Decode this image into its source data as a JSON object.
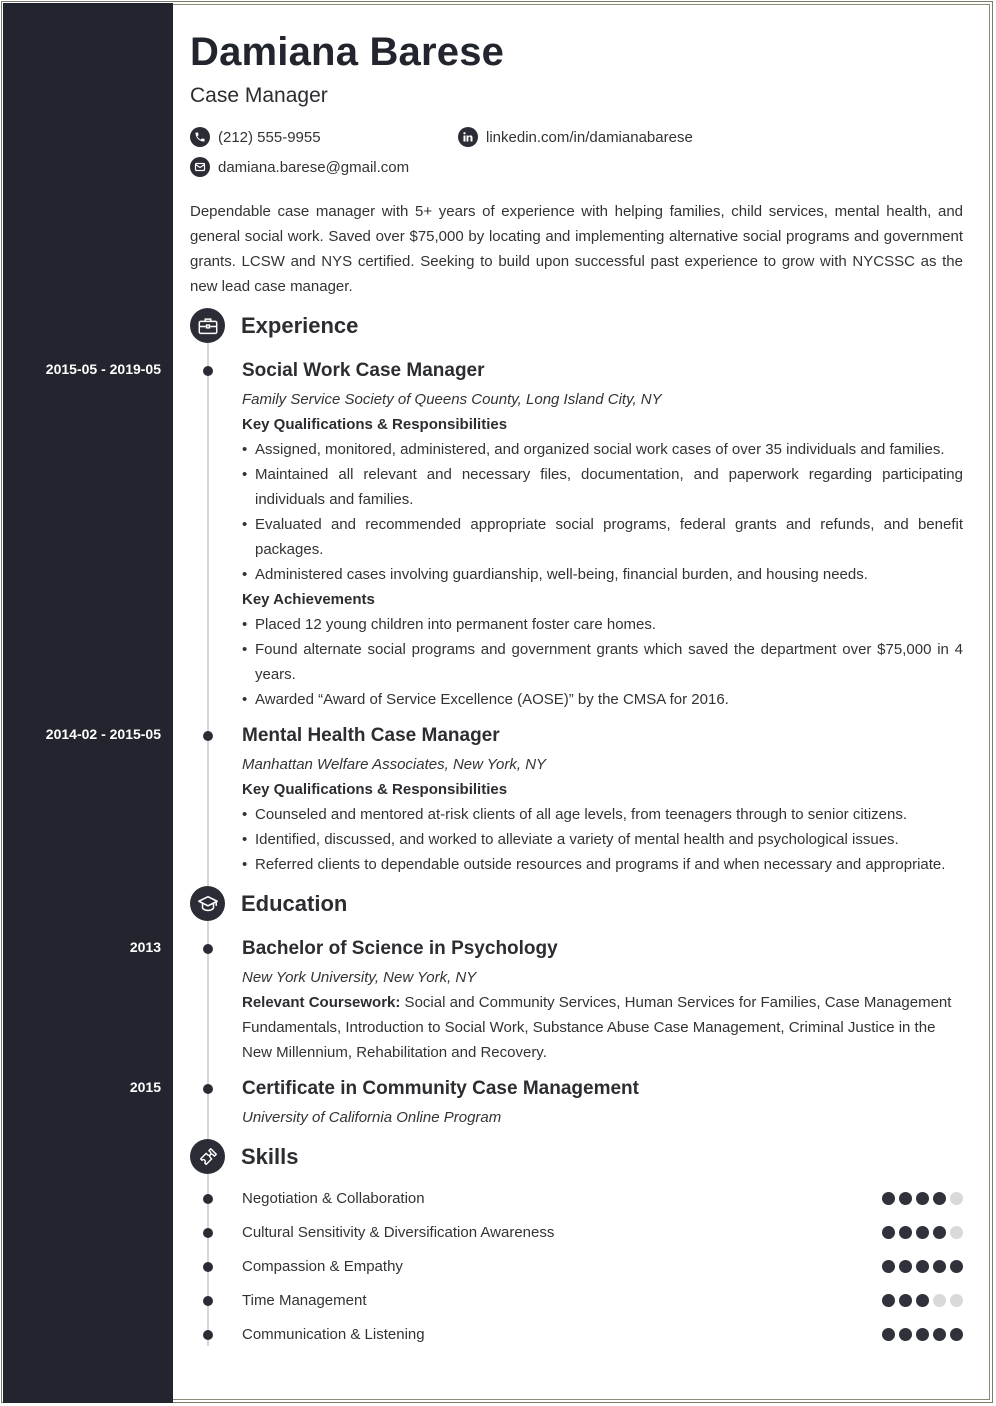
{
  "header": {
    "name": "Damiana Barese",
    "title": "Case Manager",
    "contacts": {
      "phone": "(212) 555-9955",
      "linkedin": "linkedin.com/in/damianabarese",
      "email": "damiana.barese@gmail.com"
    }
  },
  "summary": "Dependable case manager with 5+ years of experience with helping families, child services, mental health, and general social work. Saved over $75,000 by locating and implementing alternative social programs and government grants. LCSW and NYS certified. Seeking to build upon successful past experience to grow with NYCSSC as the new lead case manager.",
  "sections": {
    "experience": "Experience",
    "education": "Education",
    "skills": "Skills"
  },
  "experience": [
    {
      "dates": "2015-05 - 2019-05",
      "title": "Social Work Case Manager",
      "employer": "Family Service Society of Queens County, Long Island City, NY",
      "qual_heading": "Key Qualifications & Responsibilities",
      "qualifications": [
        "Assigned, monitored, administered, and organized social work cases of over 35 individuals and families.",
        "Maintained all relevant and necessary files, documentation, and paperwork regarding participating individuals and families.",
        "Evaluated and recommended appropriate social programs, federal grants and refunds, and benefit packages.",
        "Administered cases involving guardianship, well-being, financial burden, and housing needs."
      ],
      "ach_heading": "Key Achievements",
      "achievements": [
        "Placed 12 young children into permanent foster care homes.",
        "Found alternate social programs and government grants which saved the department over $75,000 in 4 years.",
        "Awarded “Award of Service Excellence (AOSE)” by the CMSA for 2016."
      ]
    },
    {
      "dates": "2014-02 - 2015-05",
      "title": "Mental Health Case Manager",
      "employer": "Manhattan Welfare Associates, New York, NY",
      "qual_heading": "Key Qualifications & Responsibilities",
      "qualifications": [
        "Counseled and mentored at-risk clients of all age levels, from teenagers through to senior citizens.",
        "Identified, discussed, and worked to alleviate a variety of mental health and psychological issues.",
        "Referred clients to dependable outside resources and programs if and when necessary and appropriate."
      ]
    }
  ],
  "education": [
    {
      "date": "2013",
      "degree": "Bachelor of Science in Psychology",
      "school": "New York University, New York, NY",
      "coursework_label": "Relevant Coursework:",
      "coursework": " Social and Community Services, Human Services for Families, Case Management Fundamentals, Introduction to Social Work, Substance Abuse Case Management, Criminal Justice in the New Millennium, Rehabilitation and Recovery."
    },
    {
      "date": "2015",
      "degree": "Certificate in Community Case Management",
      "school": "University of California Online Program"
    }
  ],
  "skills": [
    {
      "name": "Negotiation & Collaboration",
      "rating": 4,
      "max": 5
    },
    {
      "name": "Cultural Sensitivity & Diversification Awareness",
      "rating": 4,
      "max": 5
    },
    {
      "name": "Compassion & Empathy",
      "rating": 5,
      "max": 5
    },
    {
      "name": "Time Management",
      "rating": 3,
      "max": 5
    },
    {
      "name": "Communication & Listening",
      "rating": 5,
      "max": 5
    }
  ],
  "icons": {
    "phone": "phone-icon",
    "linkedin": "linkedin-icon",
    "email": "email-icon",
    "experience": "briefcase-icon",
    "education": "graduation-cap-icon",
    "skills": "puzzle-piece-icon"
  },
  "colors": {
    "sidebar": "#22252d",
    "accent": "#2a2d35",
    "rating_on": "#2f323b",
    "rating_off": "#d9d9d9",
    "timeline": "#d6d6d6"
  }
}
